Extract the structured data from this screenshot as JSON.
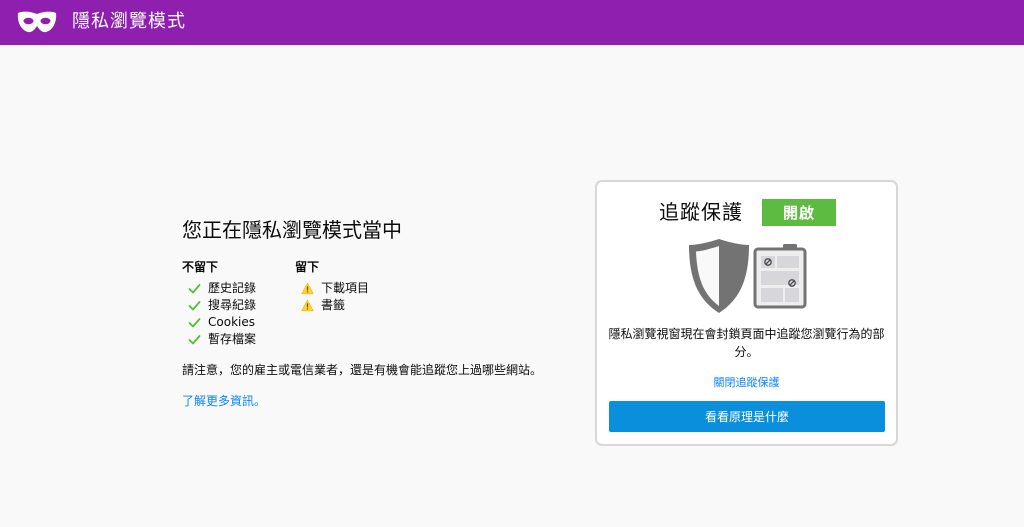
{
  "header": {
    "title": "隱私瀏覽模式",
    "icon": "private-mask-icon",
    "background": "#8f1fae"
  },
  "info": {
    "title": "您正在隱私瀏覽模式當中",
    "not_saved": {
      "heading": "不留下",
      "items": [
        "歷史記錄",
        "搜尋紀錄",
        "Cookies",
        "暫存檔案"
      ],
      "icon": "checkmark-icon"
    },
    "saved": {
      "heading": "留下",
      "items": [
        "下載項目",
        "書籤"
      ],
      "icon": "warning-icon"
    },
    "note": "請注意，您的雇主或電信業者，還是有機會能追蹤您上過哪些網站。",
    "learn_more": "了解更多資訊。"
  },
  "tracking_card": {
    "title": "追蹤保護",
    "badge": "開啟",
    "badge_color": "#5dbb42",
    "description": "隱私瀏覽視窗現在會封鎖頁面中追蹤您瀏覽行為的部分。",
    "disable_link": "關閉追蹤保護",
    "button": "看看原理是什麼",
    "button_color": "#0a8fdc",
    "illustration": "shield-blocked-content-illustration"
  }
}
